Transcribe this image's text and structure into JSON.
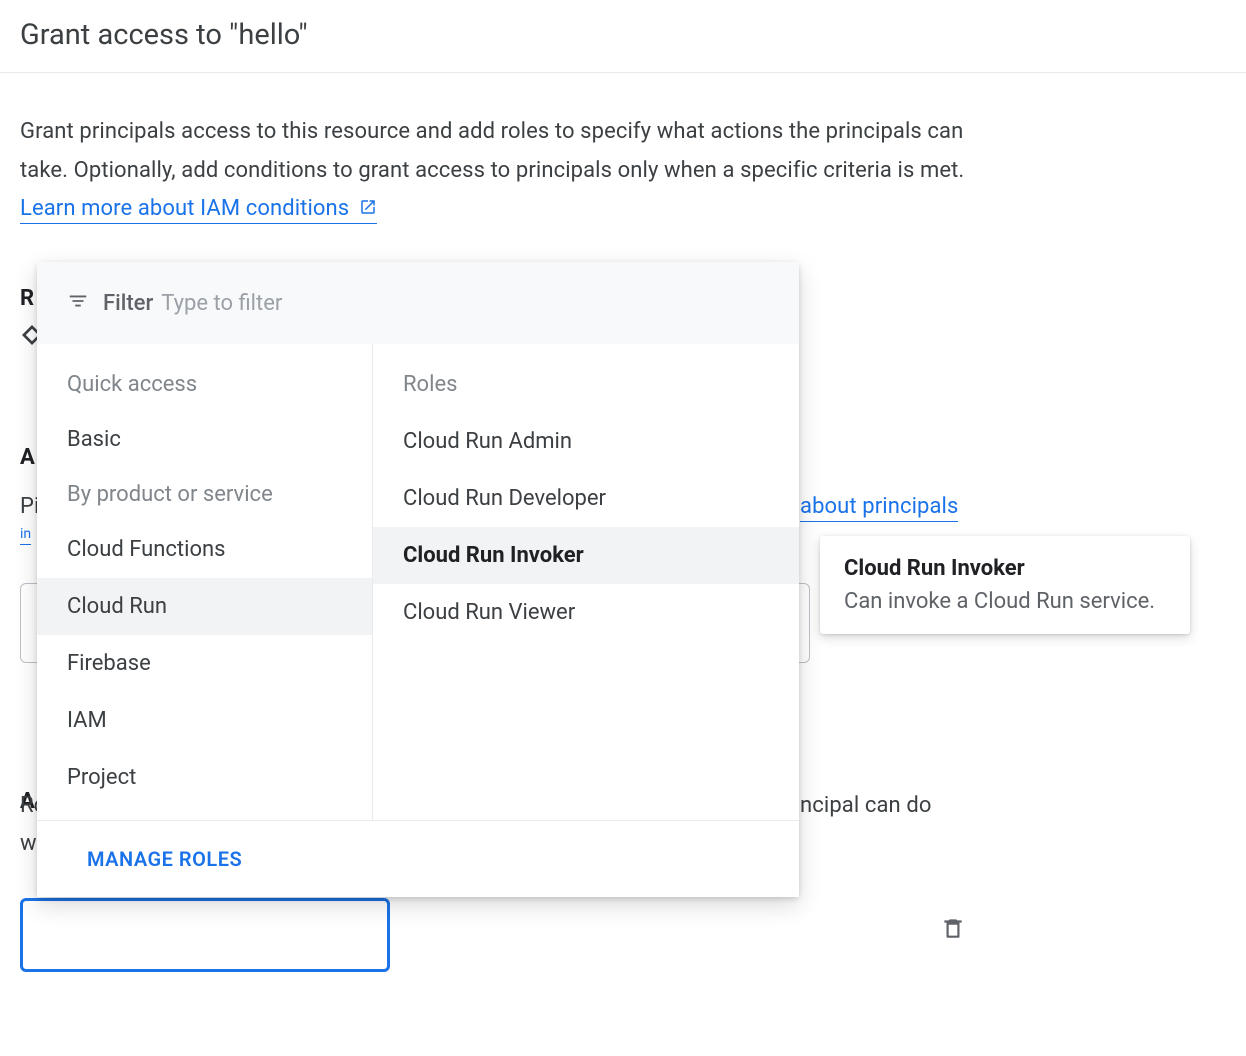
{
  "title": "Grant access to \"hello\"",
  "description": "Grant principals access to this resource and add roles to specify what actions the principals can take. Optionally, add conditions to grant access to principals only when a specific criteria is met. ",
  "learn_more_label": "Learn more about IAM conditions",
  "bg": {
    "r_char": "R",
    "a1_char": "A",
    "pi_char": "Pi",
    "in_char": "in",
    "about_principals": "about principals",
    "a2_char": "A",
    "rc_char": "Rc",
    "w_char": "w",
    "ncipal_text": "ncipal can do"
  },
  "dropdown": {
    "filter_label": "Filter",
    "filter_placeholder": "Type to filter",
    "categories": {
      "quick_access_header": "Quick access",
      "basic": "Basic",
      "by_product_header": "By product or service",
      "items": [
        "Cloud Functions",
        "Cloud Run",
        "Firebase",
        "IAM",
        "Project"
      ],
      "selected_index": 1
    },
    "roles": {
      "header": "Roles",
      "items": [
        "Cloud Run Admin",
        "Cloud Run Developer",
        "Cloud Run Invoker",
        "Cloud Run Viewer"
      ],
      "selected_index": 2
    },
    "manage_roles_label": "MANAGE ROLES"
  },
  "tooltip": {
    "title": "Cloud Run Invoker",
    "description": "Can invoke a Cloud Run service."
  }
}
